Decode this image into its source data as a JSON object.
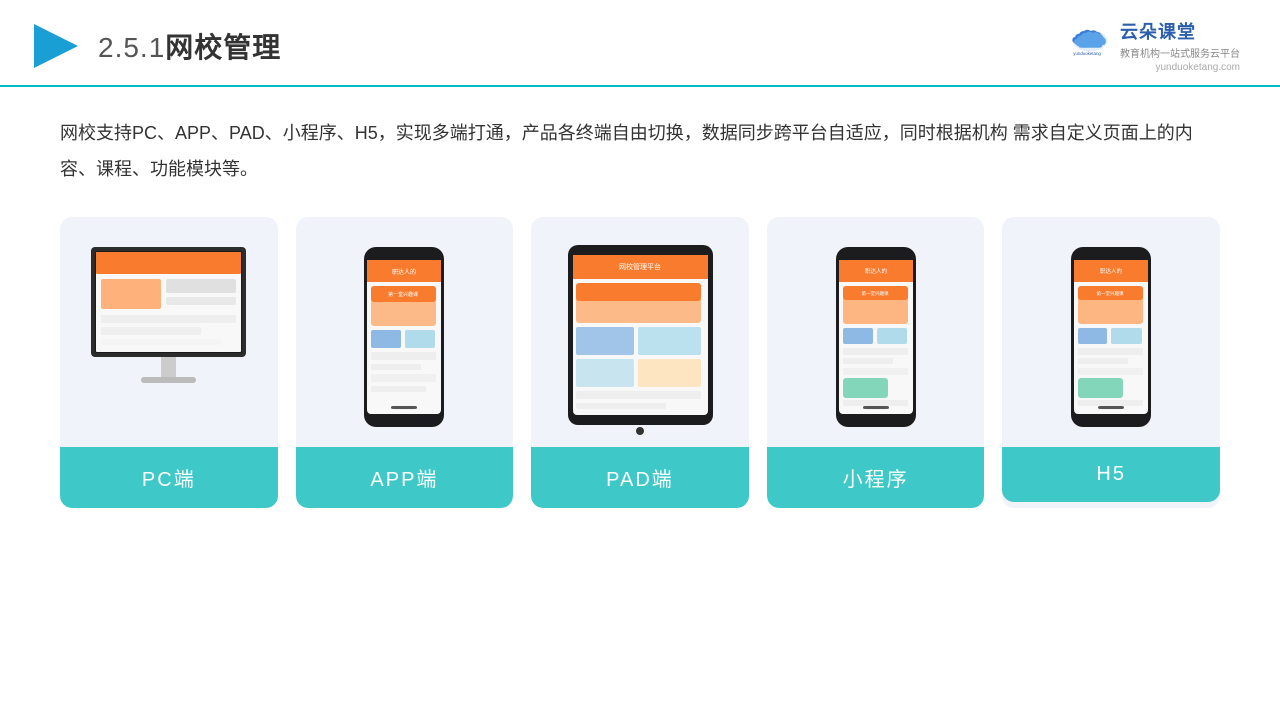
{
  "header": {
    "section_num": "2.5.1",
    "title": "网校管理",
    "logo_name": "云朵课堂",
    "logo_domain": "yunduoketang.com",
    "logo_tagline": "教育机构一站\n式服务云平台"
  },
  "description": "网校支持PC、APP、PAD、小程序、H5，实现多端打通，产品各终端自由切换，数据同步跨平台自适应，同时根据机构\n需求自定义页面上的内容、课程、功能模块等。",
  "cards": [
    {
      "id": "pc",
      "label": "PC端"
    },
    {
      "id": "app",
      "label": "APP端"
    },
    {
      "id": "pad",
      "label": "PAD端"
    },
    {
      "id": "miniapp",
      "label": "小程序"
    },
    {
      "id": "h5",
      "label": "H5"
    }
  ],
  "colors": {
    "accent": "#3fc8c8",
    "header_line": "#00b8c8",
    "card_bg": "#eef2f8",
    "text_dark": "#333333",
    "logo_blue": "#2b5fad"
  }
}
